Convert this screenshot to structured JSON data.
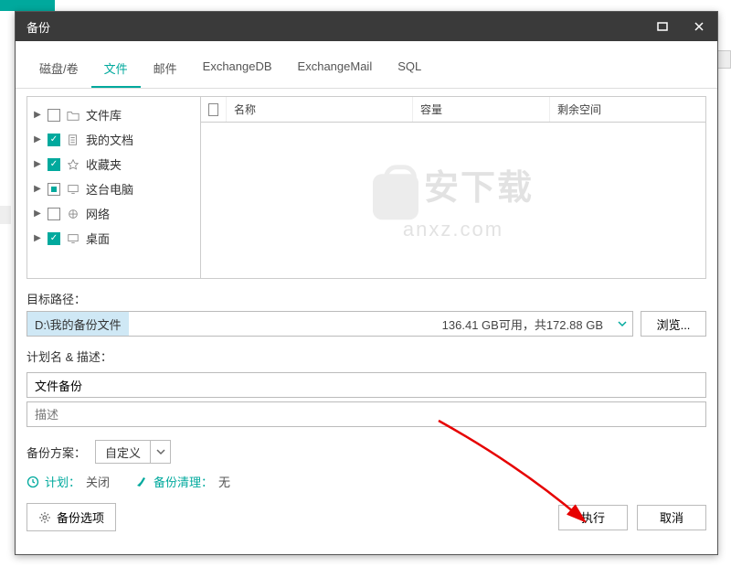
{
  "title": "备份",
  "tabs": [
    "磁盘/卷",
    "文件",
    "邮件",
    "ExchangeDB",
    "ExchangeMail",
    "SQL"
  ],
  "active_tab": 1,
  "tree": [
    {
      "label": "文件库",
      "state": "unchecked",
      "icon": "folder"
    },
    {
      "label": "我的文档",
      "state": "checked",
      "icon": "doc"
    },
    {
      "label": "收藏夹",
      "state": "checked",
      "icon": "star"
    },
    {
      "label": "这台电脑",
      "state": "mixed",
      "icon": "monitor"
    },
    {
      "label": "网络",
      "state": "unchecked",
      "icon": "globe"
    },
    {
      "label": "桌面",
      "state": "checked",
      "icon": "monitor"
    }
  ],
  "grid_headers": {
    "name": "名称",
    "capacity": "容量",
    "free": "剩余空间"
  },
  "target_label": "目标路径：",
  "target_path": "D:\\我的备份文件",
  "target_info": "136.41 GB可用，共172.88 GB",
  "browse": "浏览...",
  "plan_label": "计划名 & 描述：",
  "plan_name": "文件备份",
  "desc_placeholder": "描述",
  "scheme_label": "备份方案：",
  "scheme_value": "自定义",
  "schedule_label": "计划：",
  "schedule_value": "关闭",
  "cleanup_label": "备份清理：",
  "cleanup_value": "无",
  "options_btn": "备份选项",
  "execute": "执行",
  "cancel": "取消",
  "watermark": {
    "text": "安下载",
    "sub": "anxz.com"
  }
}
